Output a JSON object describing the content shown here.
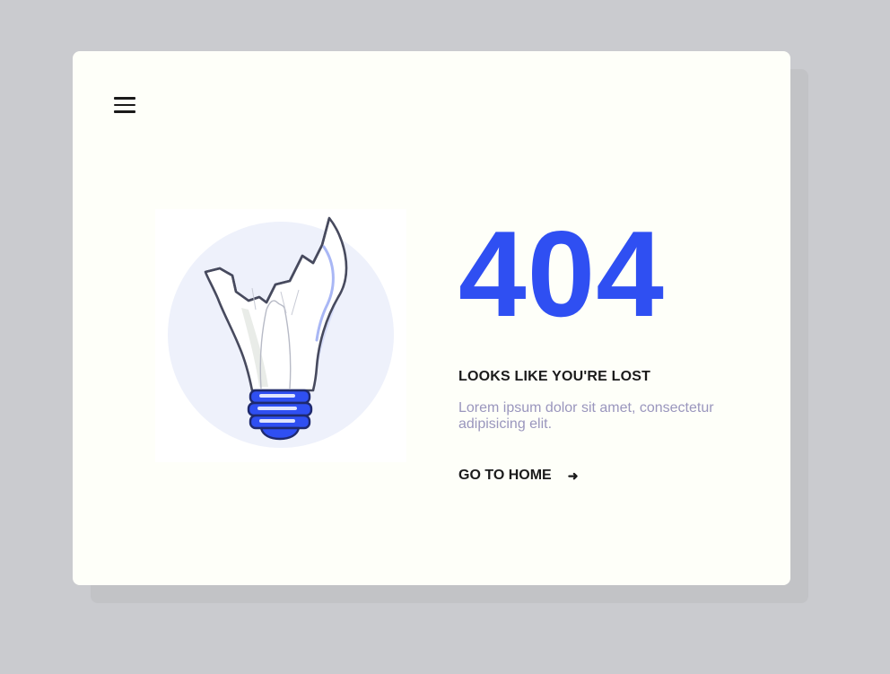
{
  "header": {
    "menu_icon": "hamburger-menu-icon"
  },
  "illustration": {
    "icon": "broken-lightbulb-icon",
    "accent_color": "#2f4ff2",
    "circle_color": "#eef1fb"
  },
  "main": {
    "error_code": "404",
    "error_color": "#2f4ff2",
    "headline": "LOOKS LIKE YOU'RE LOST",
    "description": "Lorem ipsum dolor sit amet, consectetur adipisicing elit.",
    "description_color": "#9a96bd",
    "home_link_label": "GO TO HOME",
    "home_link_icon": "arrow-right-icon",
    "home_link_arrow": "➜"
  },
  "colors": {
    "background": "#cacbcf",
    "card": "#fefff9",
    "text_dark": "#1b1b1b"
  }
}
